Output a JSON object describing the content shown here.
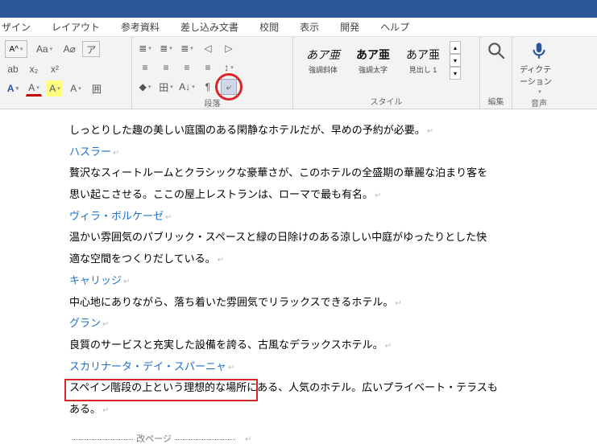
{
  "tabs": [
    "ザイン",
    "レイアウト",
    "参考資料",
    "差し込み文書",
    "校閲",
    "表示",
    "開発",
    "ヘルプ"
  ],
  "group_labels": {
    "font": "",
    "para": "段落",
    "styles": "スタイル",
    "edit": "編集",
    "voice": "音声"
  },
  "font": {
    "box1": "A^",
    "box2": "A˅",
    "case": "Aa",
    "clear": "A⌀",
    "phon": "ア",
    "strike": "ab",
    "sub": "x₂",
    "sup": "x²",
    "bold": "A",
    "color": "A",
    "hl": "A",
    "fx": "A",
    "border": "囲"
  },
  "para": {
    "bul": "≣",
    "num": "≣",
    "ml": "≣",
    "dedent": "◁",
    "indent": "▷",
    "al": "≡",
    "ac": "≡",
    "ar": "≡",
    "aj": "≡",
    "ls": "↕",
    "fill": "◆",
    "grid": "田",
    "sort": "A↓",
    "marks": "¶",
    "pb": "⤶"
  },
  "styles": [
    {
      "sample": "あア亜",
      "name": "強調斜体",
      "cls": "em1"
    },
    {
      "sample": "あア亜",
      "name": "強調太字",
      "cls": "em2"
    },
    {
      "sample": "あア亜",
      "name": "見出し 1",
      "cls": ""
    }
  ],
  "edit_label": "編集",
  "dictation_label": "ディクテーション",
  "doc": {
    "l0": "しっとりした趣の美しい庭園のある閑静なホテルだが、早めの予約が必要。",
    "h1": "ハスラー",
    "l1a": "贅沢なスィートルームとクラシックな豪華さが、このホテルの全盛期の華麗な泊まり客を",
    "l1b": "思い起こさせる。ここの屋上レストランは、ローマで最も有名。",
    "h2": "ヴィラ・ボルケーゼ",
    "l2a": "温かい雰囲気のパブリック・スペースと緑の日除けのある涼しい中庭がゆったりとした快",
    "l2b": "適な空間をつくりだしている。",
    "h3": "キャリッジ",
    "l3": "中心地にありながら、落ち着いた雰囲気でリラックスできるホテル。",
    "h4": "グラン",
    "l4": "良質のサービスと充実した設備を誇る、古風なデラックスホテル。",
    "h5": "スカリナータ・デイ・スパーニャ",
    "l5a": "スペイン階段の上という理想的な場所にある、人気のホテル。広いプライベート・テラスも",
    "l5b": "ある。",
    "pagebreak": "改ページ"
  }
}
